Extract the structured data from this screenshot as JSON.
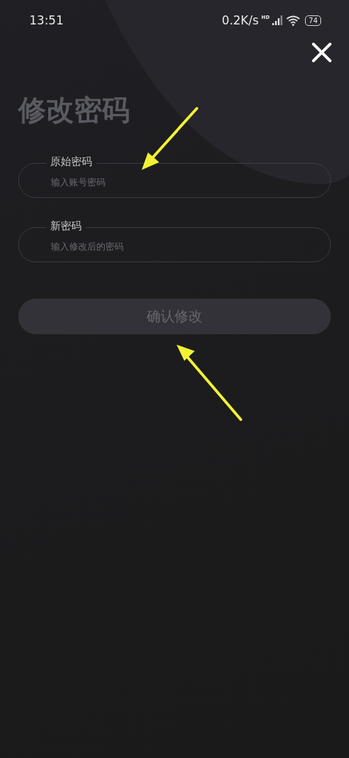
{
  "status_bar": {
    "time": "13:51",
    "speed": "0.2K/s",
    "network_badge": "HD",
    "battery": "74"
  },
  "title": "修改密码",
  "fields": [
    {
      "label": "原始密码",
      "placeholder": "输入账号密码"
    },
    {
      "label": "新密码",
      "placeholder": "输入修改后的密码"
    }
  ],
  "submit_button": {
    "label": "确认修改",
    "disabled": true
  }
}
